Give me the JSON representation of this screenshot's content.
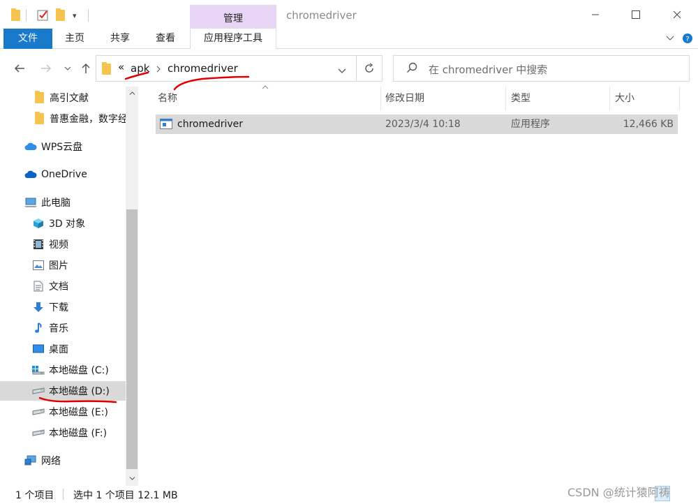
{
  "titlebar": {
    "manage_label": "管理",
    "window_title": "chromedriver"
  },
  "ribbon": {
    "tabs": [
      {
        "label": "文件"
      },
      {
        "label": "主页"
      },
      {
        "label": "共享"
      },
      {
        "label": "查看"
      },
      {
        "label": "应用程序工具"
      }
    ]
  },
  "address": {
    "overflow": "«",
    "crumbs": [
      "apk",
      "chromedriver"
    ]
  },
  "search": {
    "placeholder": "在 chromedriver 中搜索"
  },
  "sidebar": {
    "items": [
      {
        "label": "高引文献",
        "icon": "folder-icon"
      },
      {
        "label": "普惠金融，数字经",
        "icon": "folder-icon"
      },
      {
        "label": "WPS云盘",
        "icon": "wps-cloud-icon"
      },
      {
        "label": "OneDrive",
        "icon": "onedrive-icon"
      },
      {
        "label": "此电脑",
        "icon": "computer-icon"
      },
      {
        "label": "3D 对象",
        "icon": "3d-objects-icon"
      },
      {
        "label": "视频",
        "icon": "video-icon"
      },
      {
        "label": "图片",
        "icon": "pictures-icon"
      },
      {
        "label": "文档",
        "icon": "documents-icon"
      },
      {
        "label": "下载",
        "icon": "download-icon"
      },
      {
        "label": "音乐",
        "icon": "music-icon"
      },
      {
        "label": "桌面",
        "icon": "desktop-icon"
      },
      {
        "label": "本地磁盘 (C:)",
        "icon": "system-drive-icon"
      },
      {
        "label": "本地磁盘 (D:)",
        "icon": "drive-icon"
      },
      {
        "label": "本地磁盘 (E:)",
        "icon": "drive-icon"
      },
      {
        "label": "本地磁盘 (F:)",
        "icon": "drive-icon"
      },
      {
        "label": "网络",
        "icon": "network-icon"
      }
    ],
    "selected_index": 13
  },
  "filelist": {
    "columns": [
      "名称",
      "修改日期",
      "类型",
      "大小"
    ],
    "rows": [
      {
        "name": "chromedriver",
        "modified": "2023/3/4 10:18",
        "type": "应用程序",
        "size": "12,466 KB",
        "icon": "executable-icon"
      }
    ]
  },
  "status": {
    "item_count": "1 个项目",
    "selection": "选中 1 个项目  12.1 MB"
  },
  "watermark": "CSDN @统计猿阿祷",
  "colors": {
    "accent": "#1979ca",
    "manage_tab": "#e8d4f5",
    "selection": "#d9d9d9",
    "annotation": "#e00000",
    "folder": "#f4c44e"
  }
}
